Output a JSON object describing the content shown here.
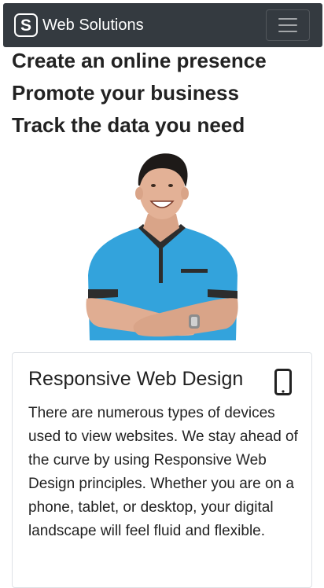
{
  "navbar": {
    "logo_letter": "S",
    "brand": "Web Solutions",
    "toggler_icon": "hamburger-menu-icon"
  },
  "headlines": [
    "Create an online presence",
    "Promote your business",
    "Track the data you need"
  ],
  "hero": {
    "image": "smiling-man-arms-crossed-photo"
  },
  "card": {
    "title": "Responsive Web Design",
    "icon": "smartphone-icon",
    "text": "There are numerous types of devices used to view websites. We stay ahead of the curve by using Responsive Web Design principles. Whether you are on a phone, tablet, or desktop, your digital landscape will feel fluid and flexible."
  },
  "colors": {
    "navbar_bg": "#343a40",
    "shirt": "#33a3dc",
    "text": "#222222"
  }
}
